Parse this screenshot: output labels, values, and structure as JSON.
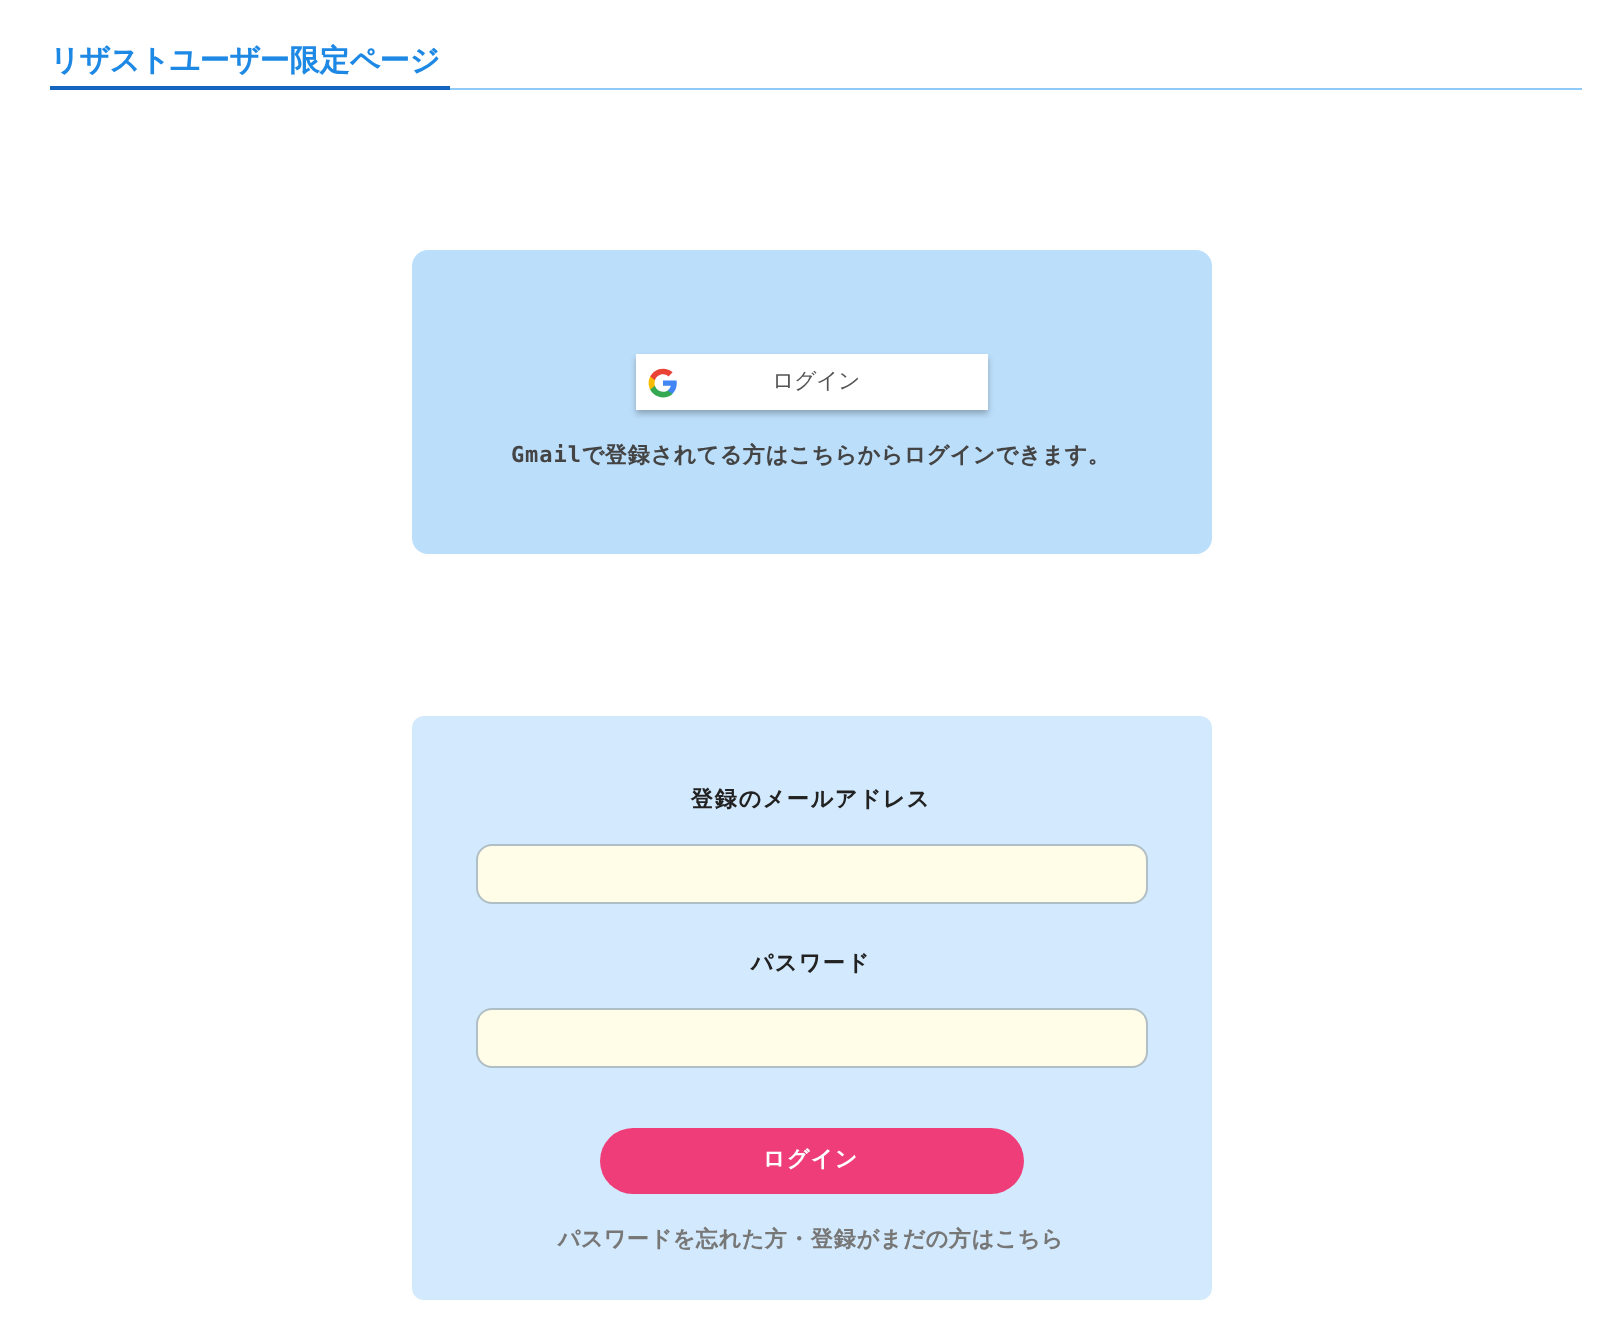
{
  "page_title": "リザストユーザー限定ページ",
  "google_login": {
    "button_label": "ログイン",
    "caption": "Gmailで登録されてる方はこちらからログインできます。"
  },
  "login_form": {
    "fields": [
      {
        "label": "登録のメールアドレス"
      },
      {
        "label": "パスワード"
      }
    ],
    "submit_label": "ログイン",
    "help_link": "パスワードを忘れた方・登録がまだの方はこちら"
  }
}
